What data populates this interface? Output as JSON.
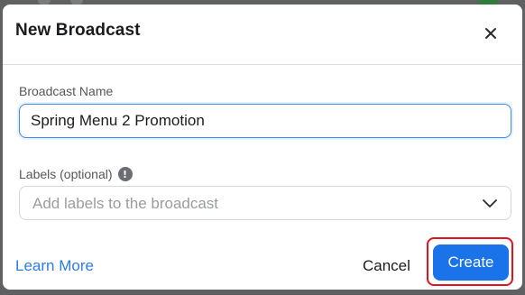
{
  "dialog": {
    "title": "New Broadcast",
    "close_icon": "close-icon"
  },
  "broadcast_name": {
    "label": "Broadcast Name",
    "value": "Spring Menu 2 Promotion"
  },
  "labels": {
    "label": "Labels (optional)",
    "info_icon": "info-icon",
    "info_glyph": "!",
    "placeholder": "Add labels to the broadcast",
    "chevron_icon": "chevron-down-icon"
  },
  "footer": {
    "learn_more": "Learn More",
    "cancel": "Cancel",
    "create": "Create"
  },
  "colors": {
    "accent": "#1a73e8",
    "link": "#2f7be0",
    "highlight": "#e0141e",
    "backdrop": "#5f6062"
  }
}
